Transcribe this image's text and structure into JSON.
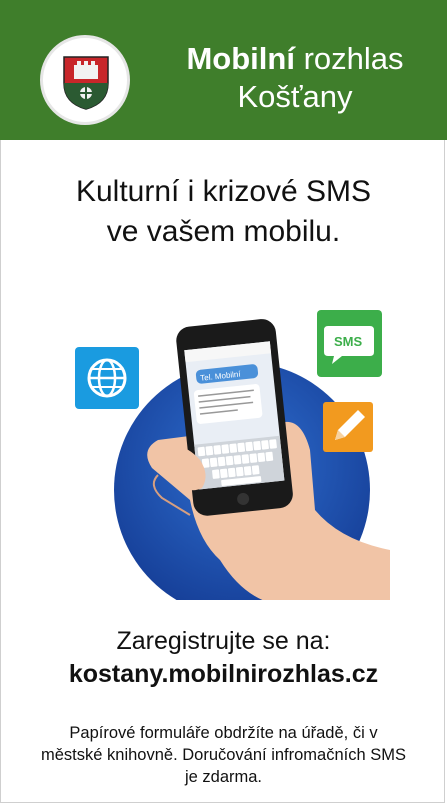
{
  "header": {
    "title_bold": "Mobilní",
    "title_rest": " rozhlas",
    "subtitle": "Košťany"
  },
  "headline": {
    "line1": "Kulturní i krizové SMS",
    "line2": "ve vašem mobilu."
  },
  "illustration": {
    "sms_badge": "SMS",
    "phone_bubble": "Tel. Mobilní",
    "icons": [
      "globe-icon",
      "sms-icon",
      "pencil-icon"
    ]
  },
  "register": {
    "line1": "Zaregistrujte se na:",
    "url": "kostany.mobilnirozhlas.cz"
  },
  "note": "Papírové formuláře obdržíte na úřadě, či v městské knihovně. Doručování infromačních SMS je zdarma.",
  "colors": {
    "header_green": "#3f7e2b",
    "circle_blue": "#1f57b8",
    "globe_tile": "#1a9be0",
    "sms_tile": "#3cae4a",
    "pencil_tile": "#f29a1f"
  }
}
